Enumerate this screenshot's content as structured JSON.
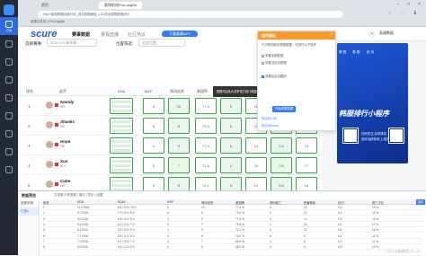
{
  "rail": {
    "items": [
      {
        "label": "行情"
      },
      {
        "label": ""
      },
      {
        "label": ""
      },
      {
        "label": ""
      },
      {
        "label": ""
      },
      {
        "label": ""
      },
      {
        "label": ""
      },
      {
        "label": ""
      },
      {
        "label": ""
      }
    ]
  },
  "browser": {
    "tabs": [
      "首页",
      "赛博前线ProLeagNe"
    ],
    "address": "http://英雄联盟战报分析_选手数据面板_LOL职业联赛数据统计",
    "bookmarks": "新建文件夹 | ProLeagNe"
  },
  "nav": {
    "brand": "scure",
    "items": [
      "赛事数据",
      "赛程直播",
      "社区热议",
      "选手数据"
    ],
    "app": "下载赛事APP",
    "user": "英雄数据"
  },
  "subtabs": [
    "赛事数据",
    "赛程赛果",
    "选手数据",
    "队伍数据"
  ],
  "filters": {
    "season_label": "选择赛事:",
    "season_value": "2023 LPL春季赛",
    "pos_label": "位置筛选:",
    "pos_value": "全部位置"
  },
  "table": {
    "headers": [
      "排名",
      "选手",
      "KDA",
      "MVP",
      "场均击杀",
      "参团率",
      "场均死亡",
      "伤害转化",
      "补刀",
      "分均伤害",
      "视野",
      "死亡占比",
      "场均经济"
    ],
    "rows": [
      {
        "rank": "1",
        "name": "Iwandy",
        "team": "WE",
        "kda": "8.4",
        "vals": [
          "5",
          "10",
          "77.3",
          "5",
          "10",
          "0.3",
          "15",
          "10",
          "10.1"
        ]
      },
      {
        "rank": "2",
        "name": "Shanks",
        "team": "WE",
        "kda": "7.9",
        "vals": [
          "6",
          "8",
          "73.4",
          "5",
          "11",
          "0.4",
          "14",
          "12",
          "9.8"
        ]
      },
      {
        "rank": "3",
        "name": "Hope",
        "team": "WE",
        "kda": "6.5",
        "vals": [
          "4",
          "9",
          "77.3",
          "6",
          "13",
          "0.6",
          "13",
          "11",
          "10.4"
        ]
      },
      {
        "rank": "4",
        "name": "Xun",
        "team": "BLG",
        "kda": "6.2",
        "vals": [
          "5",
          "7",
          "71.8",
          "4",
          "10",
          "0.5",
          "17",
          "13",
          "10.9"
        ]
      },
      {
        "rank": "5",
        "name": "Cube",
        "team": "WE",
        "kda": "5.9",
        "vals": [
          "3",
          "9",
          "72.1",
          "4",
          "12",
          "0.6",
          "16",
          "10",
          "9.7"
        ]
      }
    ]
  },
  "tooltip": "数据均由各大赛事官方统计数据整理汇总",
  "panel": {
    "title": "插件面板",
    "lines": [
      "已识别到网页表格数据，可进行以下操作",
      "",
      ""
    ],
    "checks": [
      "采集全部数据",
      "采集当前页数据",
      "采集后自动翻页"
    ],
    "button": "开始采集数据",
    "links": [
      "导出为CSV",
      "导出为Excel"
    ]
  },
  "ad": {
    "top": "赛程 · 数据 · 资讯",
    "big": "韩服排行小程序",
    "l1": "扫码关注 实时排名",
    "l2": "选手战绩查询 上线提醒"
  },
  "dev": {
    "title": "数据预览",
    "tool": "共采集 5 条数据 | 清空 | 导出 | 设置",
    "side": [
      "全部字段",
      "已选1"
    ],
    "headers": [
      "序号",
      "KDA",
      "KDA1",
      "MVP",
      "场均击杀",
      "参团率",
      "场均死亡",
      "伤害转化",
      "补刀",
      "死亡占比"
    ],
    "rows": [
      [
        "1",
        "11.0 KDA",
        "8.4 / 5.0 / 10.0",
        "5",
        "10",
        "77.3 %",
        "5",
        "10",
        "0.3",
        "15 %"
      ],
      [
        "2",
        "9.7 KDA",
        "7.9 / 6.0 / 8.0",
        "6",
        "8",
        "73.4 %",
        "5",
        "11",
        "0.4",
        "14 %"
      ],
      [
        "3",
        "9.0 KDA",
        "6.5 / 4.0 / 9.0",
        "4",
        "9",
        "77.3 %",
        "6",
        "13",
        "0.6",
        "13 %"
      ],
      [
        "4",
        "8.4 KDA",
        "6.2 / 5.0 / 7.0",
        "5",
        "7",
        "71.8 %",
        "4",
        "10",
        "0.5",
        "17 %"
      ],
      [
        "5",
        "8.1 KDA",
        "5.9 / 3.0 / 9.0",
        "3",
        "9",
        "72.1 %",
        "4",
        "12",
        "0.6",
        "16 %"
      ],
      [
        "6",
        "7.7 KDA",
        "5.5 / 4.0 / 8.0",
        "4",
        "8",
        "70.0 %",
        "5",
        "9",
        "0.4",
        "12 %"
      ],
      [
        "7",
        "7.3 KDA",
        "5.1 / 3.0 / 7.0",
        "3",
        "7",
        "69.4 %",
        "3",
        "8",
        "0.3",
        "11 %"
      ],
      [
        "8",
        "6.9 KDA",
        "4.8 / 2.0 / 6.0",
        "2",
        "6",
        "68.2 %",
        "3",
        "9",
        "0.5",
        "10 %"
      ]
    ],
    "op": "操作",
    "watermark": "CSDN @英雄联盟_Fk_LOL"
  }
}
